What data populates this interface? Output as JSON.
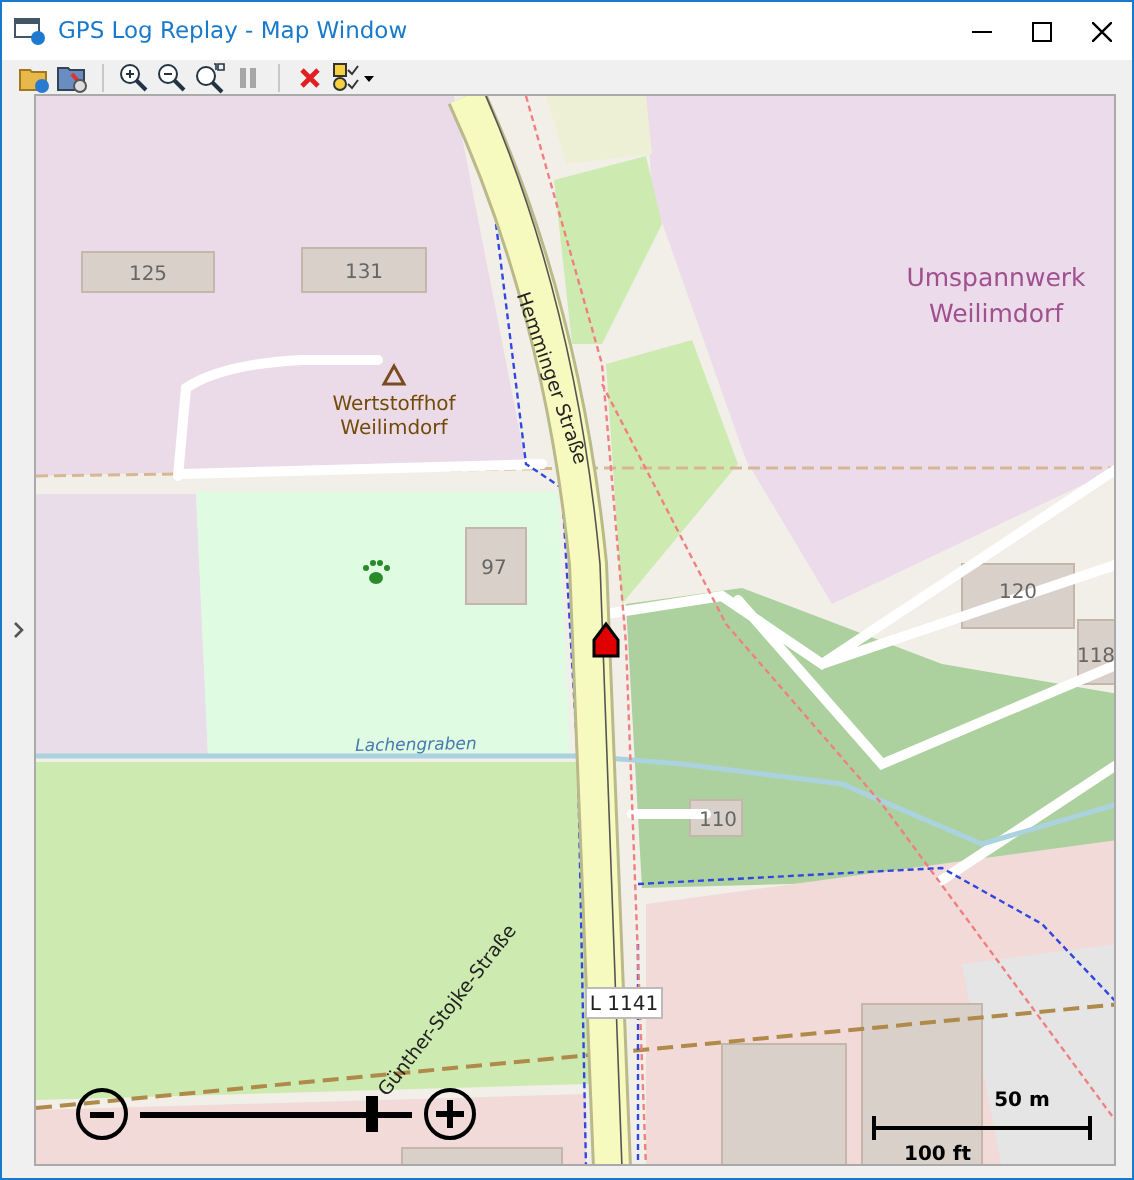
{
  "window": {
    "title": "GPS Log Replay - Map Window"
  },
  "toolbar": [
    {
      "kind": "open",
      "disabled": false
    },
    {
      "kind": "settings",
      "disabled": false
    },
    {
      "kind": "separator"
    },
    {
      "kind": "zoom-in",
      "disabled": false
    },
    {
      "kind": "zoom-out",
      "disabled": false
    },
    {
      "kind": "zoom-reset",
      "disabled": false
    },
    {
      "kind": "pause",
      "disabled": true
    },
    {
      "kind": "separator"
    },
    {
      "kind": "delete",
      "disabled": false
    },
    {
      "kind": "checklist",
      "disabled": false
    }
  ],
  "map": {
    "labels": [
      {
        "kind": "house-number",
        "text": "125"
      },
      {
        "kind": "house-number",
        "text": "131"
      },
      {
        "kind": "place",
        "text": "Wertstoffhof Weilimdorf"
      },
      {
        "kind": "area",
        "text": "Umspannwerk Weilimdorf"
      },
      {
        "kind": "street",
        "text": "Hemminger Straße"
      },
      {
        "kind": "house-number",
        "text": "97"
      },
      {
        "kind": "house-number",
        "text": "120"
      },
      {
        "kind": "house-number",
        "text": "118"
      },
      {
        "kind": "water",
        "text": "Lachengraben"
      },
      {
        "kind": "house-number",
        "text": "110"
      },
      {
        "kind": "street",
        "text": "Günther-Stojke-Straße"
      },
      {
        "kind": "road-ref",
        "text": "L 1141"
      }
    ],
    "zoom": {
      "level": 0.87
    },
    "scale": {
      "metric": "50 m",
      "imperial": "100 ft"
    }
  }
}
